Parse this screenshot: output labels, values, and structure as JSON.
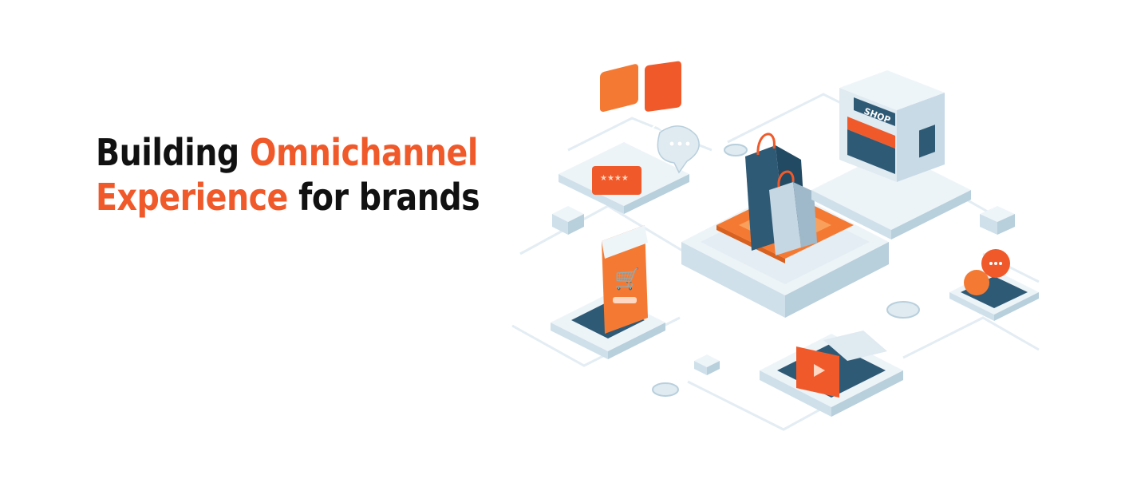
{
  "headline": {
    "line1_part1": "Building",
    "line1_part2": "Omnichannel",
    "line2_part1": "Experience",
    "line2_part2": "for brands"
  },
  "illustration": {
    "shop_sign": "SHOP"
  },
  "colors": {
    "accent": "#f05a2b",
    "dark_text": "#111111",
    "navy": "#2f5a75",
    "platform": "#e6f0f6"
  }
}
